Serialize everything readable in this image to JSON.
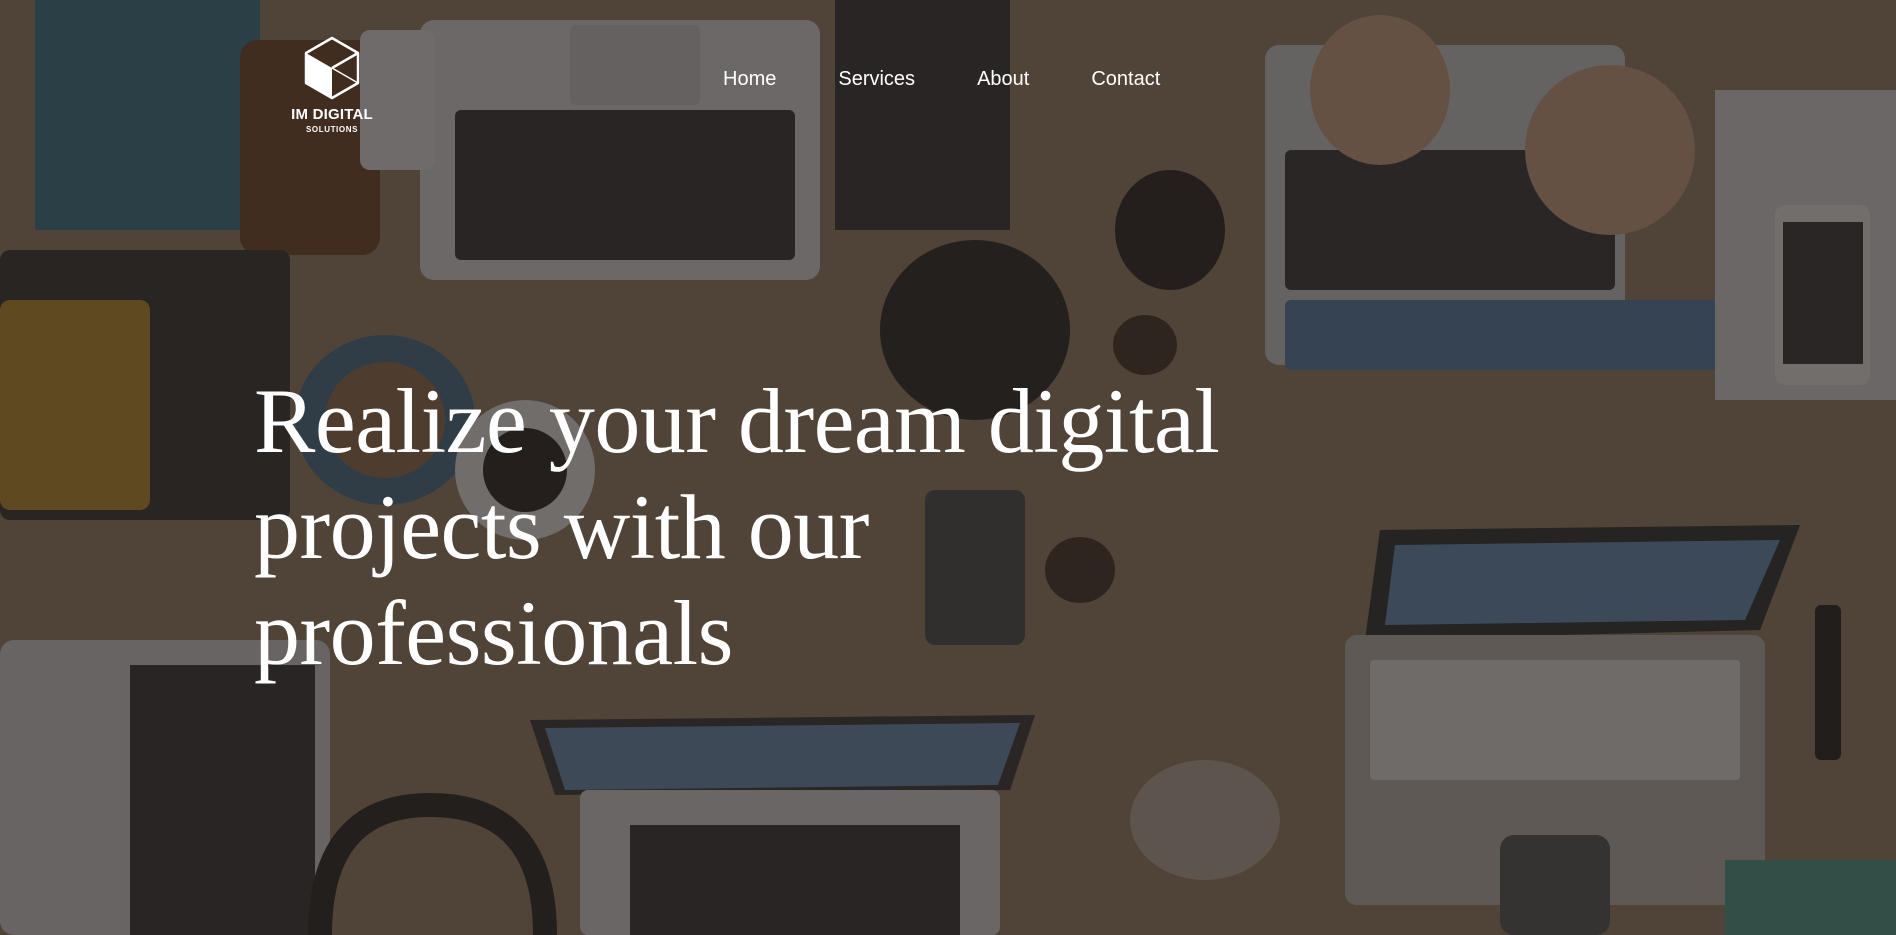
{
  "logo": {
    "icon": "cube-icon",
    "name": "IM DIGITAL",
    "subtitle": "SOLUTIONS"
  },
  "nav": {
    "items": [
      {
        "label": "Home"
      },
      {
        "label": "Services"
      },
      {
        "label": "About"
      },
      {
        "label": "Contact"
      }
    ]
  },
  "hero": {
    "headline_lines": [
      "Realize your dream digital",
      "projects with our",
      "professionals"
    ],
    "background": "overhead-desk-with-laptops-photo"
  },
  "colors": {
    "text": "#ffffff",
    "overlay": "#28221e"
  }
}
